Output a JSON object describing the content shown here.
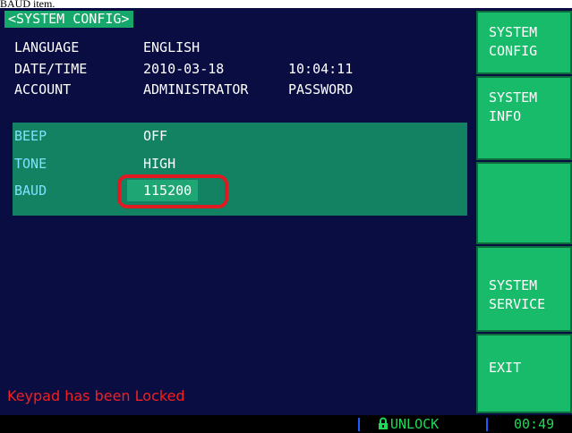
{
  "caption": "BAUD item.",
  "header": {
    "title": "<SYSTEM CONFIG>"
  },
  "settings": [
    {
      "label": "LANGUAGE",
      "value": "ENGLISH"
    },
    {
      "label": "DATE/TIME",
      "value": "2010-03-18",
      "value2": "10:04:11"
    },
    {
      "label": "ACCOUNT",
      "value": "ADMINISTRATOR",
      "value2": "PASSWORD"
    }
  ],
  "options": [
    {
      "label": "BEEP",
      "value": "OFF"
    },
    {
      "label": "TONE",
      "value": "HIGH"
    },
    {
      "label": "BAUD",
      "value": "115200"
    }
  ],
  "softkeys": [
    {
      "label": "SYSTEM\nCONFIG"
    },
    {
      "label": "SYSTEM\nINFO"
    },
    {
      "label": ""
    },
    {
      "label": "SYSTEM\nSERVICE"
    },
    {
      "label": "EXIT"
    }
  ],
  "message": "Keypad has been Locked",
  "status": {
    "lock_state": "UNLOCK",
    "clock": "00:49"
  },
  "colors": {
    "screen_bg": "#0a0d42",
    "panel": "#128262",
    "softkey": "#18bb69",
    "alert": "#f22020",
    "status_text": "#21d957",
    "highlight_ring": "#e01a20"
  },
  "icons": {
    "lock": "lock-icon"
  }
}
